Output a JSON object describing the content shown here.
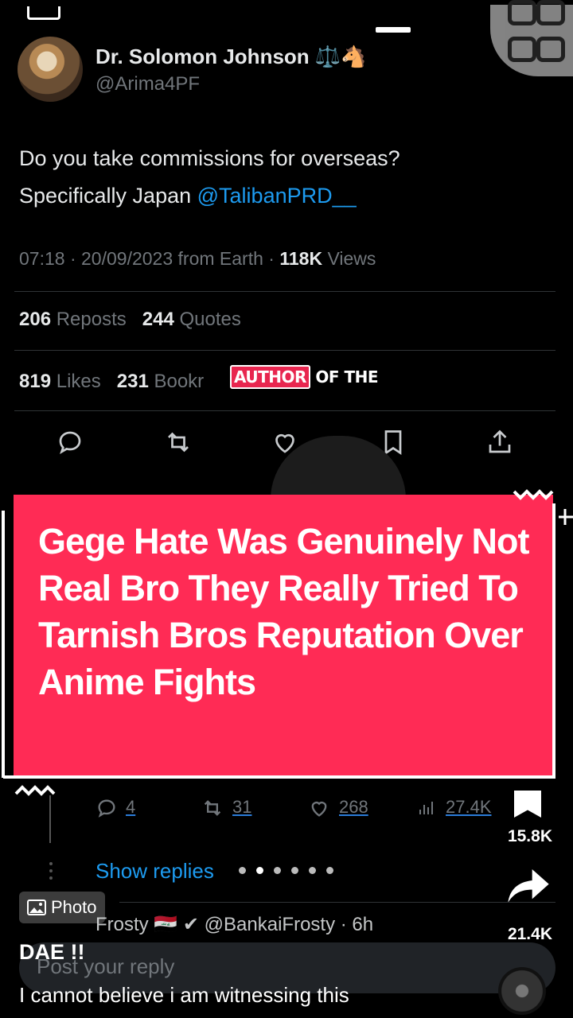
{
  "tweet": {
    "display_name": "Dr. Solomon Johnson ⚖️🐴",
    "handle": "@Arima4PF",
    "text_line1": "Do you take commissions for overseas?",
    "text_line2_prefix": "Specifically Japan ",
    "text_mention": "@TalibanPRD__",
    "time": "07:18",
    "date": "20/09/2023 from Earth",
    "views_count": "118K",
    "views_label": " Views",
    "reposts_count": "206",
    "reposts_label": " Reposts",
    "quotes_count": "244",
    "quotes_label": " Quotes",
    "likes_count": "819",
    "likes_label": " Likes",
    "bookmarks_count": "231",
    "bookmarks_label": " Bookr"
  },
  "overlay": {
    "label_boxed": "AUTHOR",
    "label_rest": " OF THE",
    "caption": "Gege Hate Was Genuinely Not Real Bro They Really Tried To Tarnish Bros Reputation Over Anime Fights"
  },
  "reply": {
    "comments": "4",
    "reposts": "31",
    "likes": "268",
    "views": "27.4K",
    "show_replies": "Show replies",
    "next_author": "Frosty 🇮🇶 ✔ @BankaiFrosty · 6h",
    "placeholder": "Post your reply"
  },
  "rail": {
    "bookmark_count": "15.8K",
    "share_count": "21.4K"
  },
  "post": {
    "badge": "Photo",
    "title": "DAE !!",
    "description": "I cannot believe i am witnessing this"
  },
  "carousel": {
    "total": 6,
    "active_index": 1
  },
  "colors": {
    "accent_red": "#ff2b55",
    "link_blue": "#1d9bf0",
    "muted": "#71767b"
  }
}
